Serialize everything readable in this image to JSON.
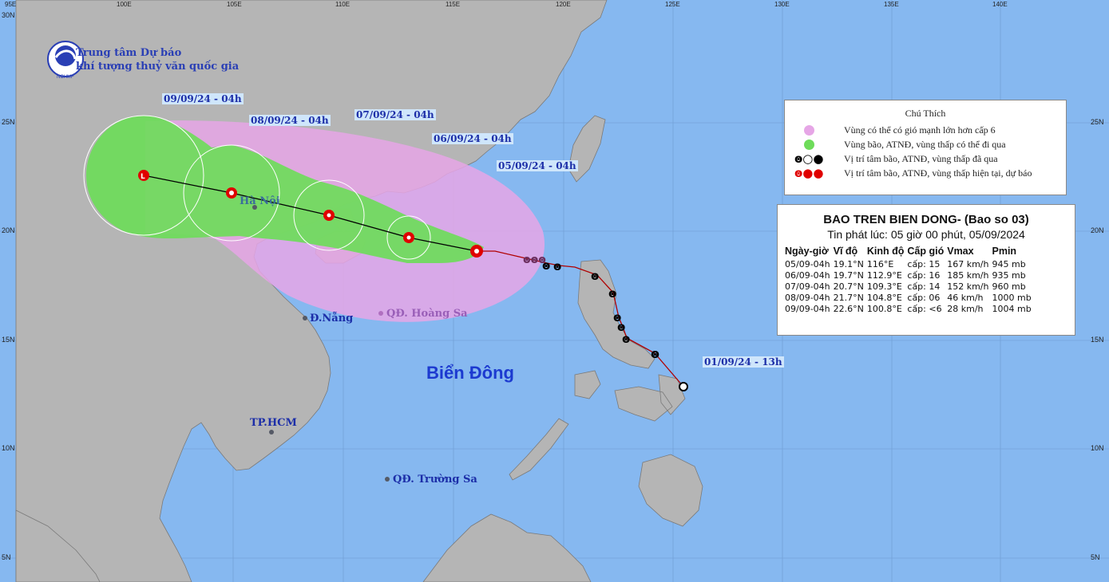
{
  "agency": {
    "line1": "Trung tâm Dự báo",
    "line2": "khí tượng thuỷ văn quốc gia",
    "logo_text": "NCHMF"
  },
  "forecast_labels": [
    "09/09/24 - 04h",
    "08/09/24 - 04h",
    "07/09/24 - 04h",
    "06/09/24 - 04h",
    "05/09/24 - 04h",
    "01/09/24 - 13h"
  ],
  "places": {
    "hanoi": "Hà Nội",
    "danang": "Đ.Nẵng",
    "hoangsa": "QĐ. Hoàng Sa",
    "hcm": "TP.HCM",
    "truongsa": "QĐ. Trường Sa",
    "sea": "Biển Đông"
  },
  "legend": {
    "title": "Chú Thích",
    "items": [
      {
        "text": "Vùng có thể có gió mạnh lớn hơn cấp 6",
        "color": "#e6a6e6"
      },
      {
        "text": "Vùng bão, ATNĐ, vùng thấp có thể đi qua",
        "color": "#6edc5a"
      },
      {
        "text": "Vị trí tâm bão, ATNĐ, vùng thấp đã qua",
        "color": "#000000"
      },
      {
        "text": "Vị trí tâm bão, ATNĐ, vùng thấp hiện tại, dự báo",
        "color": "#e00000"
      }
    ]
  },
  "bulletin": {
    "title": "BAO TREN BIEN DONG- (Bao so 03)",
    "issued": "Tin phát lúc: 05 giờ 00 phút, 05/09/2024",
    "headers": [
      "Ngày-giờ",
      "Vĩ độ",
      "Kinh độ",
      "Cấp gió",
      "Vmax",
      "Pmin"
    ],
    "rows": [
      [
        "05/09-04h",
        "19.1°N",
        "116°E",
        "cấp: 15",
        "167 km/h",
        "945 mb"
      ],
      [
        "06/09-04h",
        "19.7°N",
        "112.9°E",
        "cấp: 16",
        "185 km/h",
        "935 mb"
      ],
      [
        "07/09-04h",
        "20.7°N",
        "109.3°E",
        "cấp: 14",
        "152 km/h",
        "960 mb"
      ],
      [
        "08/09-04h",
        "21.7°N",
        "104.8°E",
        "cấp: 06",
        "46 km/h",
        "1000 mb"
      ],
      [
        "09/09-04h",
        "22.6°N",
        "100.8°E",
        "cấp: <6",
        "28 km/h",
        "1004 mb"
      ]
    ]
  },
  "lon_ticks": [
    "95E",
    "100E",
    "105E",
    "110E",
    "115E",
    "120E",
    "125E",
    "130E",
    "135E",
    "140E"
  ],
  "lat_ticks": [
    "30N",
    "25N",
    "20N",
    "15N",
    "10N",
    "5N"
  ],
  "colors": {
    "sea": "#86b8f0",
    "land": "#b5b5b5",
    "wind_zone": "#e6a6e6",
    "storm_zone": "#6edc5a",
    "track_past": "#000000",
    "track_forecast": "#e00000"
  }
}
